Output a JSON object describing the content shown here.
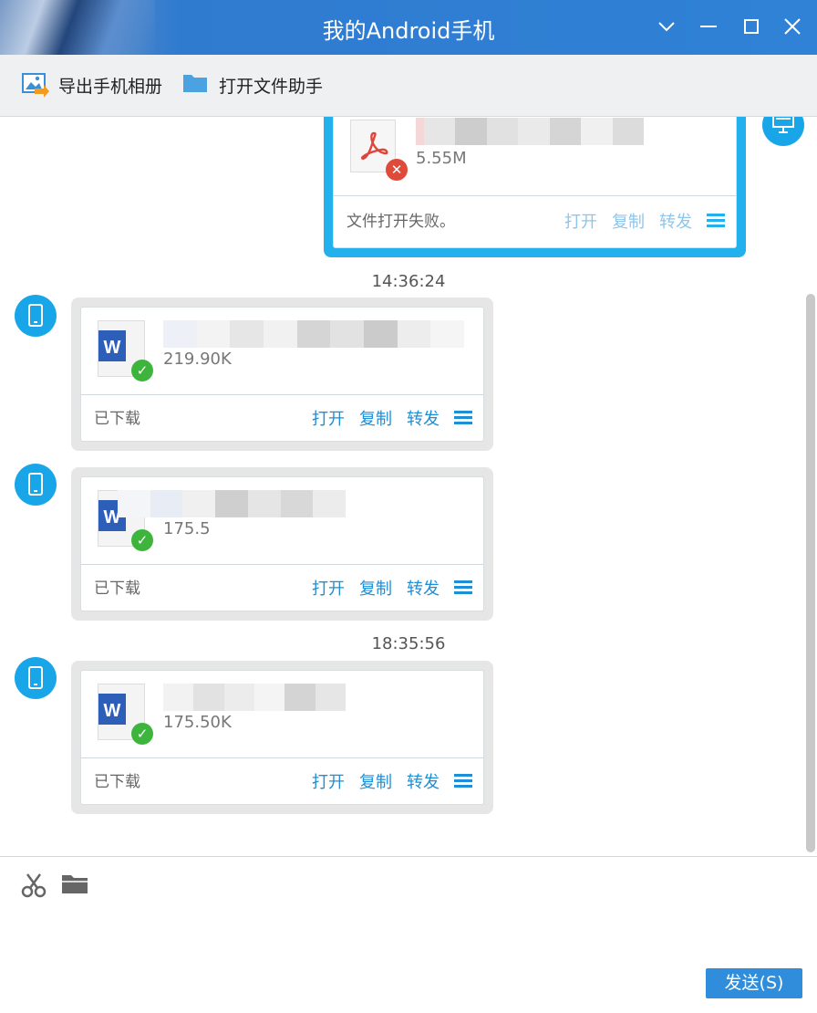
{
  "window": {
    "title": "我的Android手机"
  },
  "toolbar": {
    "export_album": "导出手机相册",
    "open_file_helper": "打开文件助手"
  },
  "actions": {
    "open": "打开",
    "copy": "复制",
    "forward": "转发"
  },
  "messages": [
    {
      "sender": "pc",
      "file_type": "pdf",
      "size": "5.55M",
      "status": "文件打开失败。"
    },
    {
      "time": "14:36:24",
      "sender": "phone",
      "file_type": "word",
      "size": "219.90K",
      "status": "已下载"
    },
    {
      "sender": "phone",
      "file_type": "word",
      "size": "175.5",
      "status": "已下载"
    },
    {
      "time": "18:35:56",
      "sender": "phone",
      "file_type": "word",
      "size": "175.50K",
      "status": "已下载"
    }
  ],
  "input": {
    "send_label": "发送(S)"
  },
  "colors": {
    "accent": "#22b1ec",
    "link": "#1d8fd6",
    "titlebar": "#2f82d6",
    "send": "#2f8ddb"
  }
}
